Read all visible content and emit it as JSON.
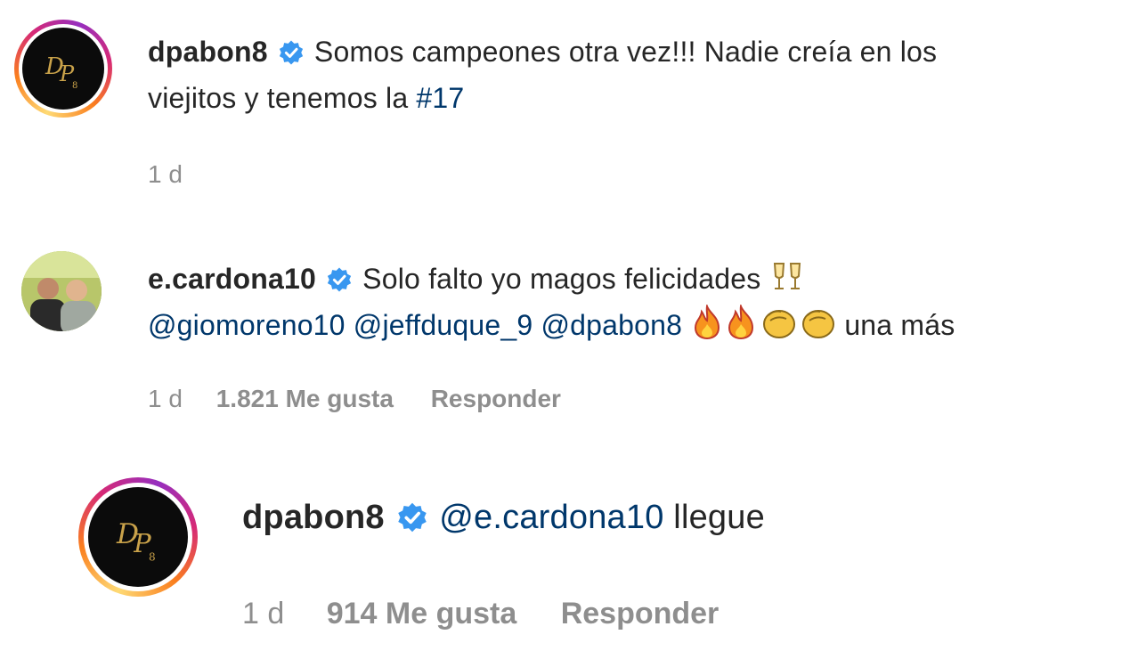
{
  "comments": [
    {
      "username": "dpabon8",
      "text_line1": "Somos campeones otra vez!!! Nadie creía en los",
      "text_line2_prefix": "viejitos y tenemos la ",
      "hashtag": "#17",
      "time": "1 d",
      "avatar_logo_text": "DP",
      "avatar_logo_sub": "8"
    },
    {
      "username": "e.cardona10",
      "text_line1": "Solo falto yo magos felicidades",
      "mentions": [
        "@giomoreno10",
        "@jeffduque_9",
        "@dpabon8"
      ],
      "text_suffix": "una más",
      "emojis": [
        "clinking-glasses-icon",
        "fire-icon",
        "fire-icon",
        "clapping-hands-icon",
        "clapping-hands-icon"
      ],
      "time": "1 d",
      "likes": "1.821 Me gusta",
      "reply_label": "Responder"
    }
  ],
  "reply": {
    "username": "dpabon8",
    "mention": "@e.cardona10",
    "text": "llegue",
    "time": "1 d",
    "likes": "914 Me gusta",
    "reply_label": "Responder",
    "avatar_logo_text": "DP",
    "avatar_logo_sub": "8"
  },
  "colors": {
    "verified": "#3897f0",
    "link": "#00376b",
    "meta": "#8e8e8e",
    "logo_gold": "#c9a24a"
  }
}
